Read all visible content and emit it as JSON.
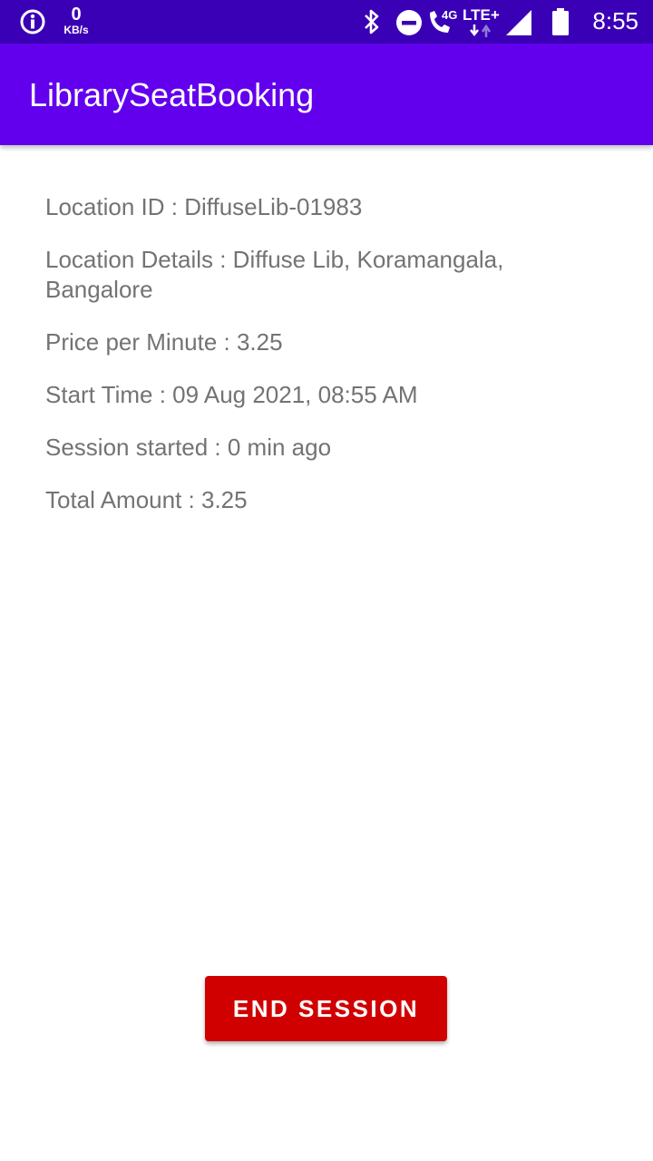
{
  "status_bar": {
    "data_speed_value": "0",
    "data_speed_unit": "KB/s",
    "network_type": "4G",
    "lte_label": "LTE+",
    "time": "8:55",
    "icons": [
      "info-icon",
      "bluetooth-icon",
      "do-not-disturb-icon",
      "wifi-calling-icon",
      "lte-data-arrows-icon",
      "signal-icon",
      "battery-icon"
    ]
  },
  "app_bar": {
    "title": "LibrarySeatBooking"
  },
  "details": {
    "location_id": "Location ID : DiffuseLib-01983",
    "location_details": "Location Details : Diffuse Lib, Koramangala, Bangalore",
    "price_per_minute": "Price per Minute : 3.25",
    "start_time": "Start Time : 09 Aug 2021, 08:55 AM",
    "session_started": "Session started : 0 min ago",
    "total_amount": "Total Amount : 3.25"
  },
  "actions": {
    "end_session_label": "END SESSION"
  },
  "colors": {
    "status_bar": "#3a00b6",
    "app_bar": "#6200ee",
    "text_secondary": "#737373",
    "end_button": "#d10000"
  }
}
